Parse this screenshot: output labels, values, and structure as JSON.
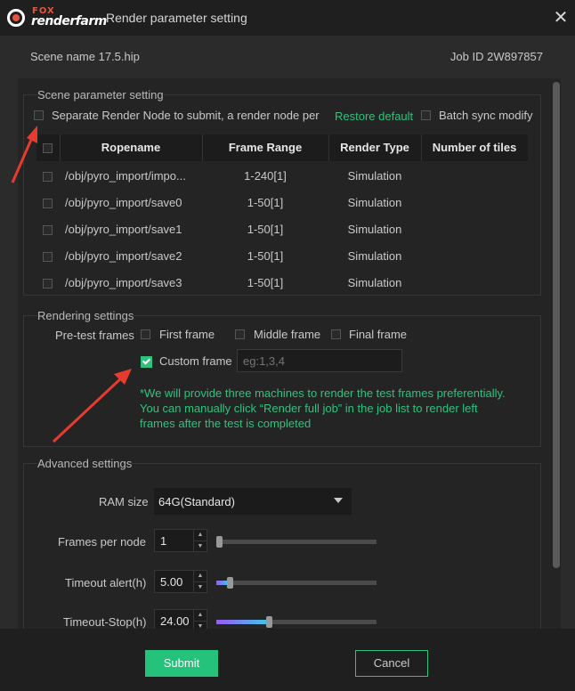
{
  "app": {
    "logo_top": "FOX",
    "logo_bottom": "renderfarm",
    "window_title": "Render parameter setting"
  },
  "info": {
    "scene_name": "Scene name  17.5.hip",
    "job_id": "Job ID  2W897857"
  },
  "scene_section": {
    "title": "Scene parameter setting",
    "separate_label": "Separate Render Node to submit, a render node per",
    "restore_default": "Restore default",
    "batch_sync_label": "Batch sync modify",
    "table": {
      "columns": [
        "Ropename",
        "Frame Range",
        "Render Type",
        "Number of tiles"
      ],
      "rows": [
        {
          "ropename": "/obj/pyro_import/impo...",
          "frame_range": "1-240[1]",
          "render_type": "Simulation",
          "tiles": ""
        },
        {
          "ropename": "/obj/pyro_import/save0",
          "frame_range": "1-50[1]",
          "render_type": "Simulation",
          "tiles": ""
        },
        {
          "ropename": "/obj/pyro_import/save1",
          "frame_range": "1-50[1]",
          "render_type": "Simulation",
          "tiles": ""
        },
        {
          "ropename": "/obj/pyro_import/save2",
          "frame_range": "1-50[1]",
          "render_type": "Simulation",
          "tiles": ""
        },
        {
          "ropename": "/obj/pyro_import/save3",
          "frame_range": "1-50[1]",
          "render_type": "Simulation",
          "tiles": ""
        }
      ]
    }
  },
  "render_section": {
    "title": "Rendering settings",
    "pretest_label": "Pre-test frames",
    "first_frame": "First frame",
    "middle_frame": "Middle frame",
    "final_frame": "Final frame",
    "custom_frame": "Custom frame",
    "custom_frame_checked": true,
    "custom_frame_placeholder": "eg:1,3,4",
    "note_lines": [
      "*We will provide three machines to render the test frames preferentially.",
      "You can manually click “Render full job” in the job list to render left",
      "frames after the test is completed"
    ]
  },
  "advanced_section": {
    "title": "Advanced settings",
    "ram_label": "RAM size",
    "ram_value": "64G(Standard)",
    "frames_per_node_label": "Frames per node",
    "frames_per_node_value": "1",
    "timeout_alert_label": "Timeout alert(h)",
    "timeout_alert_value": "5.00",
    "timeout_stop_label": "Timeout-Stop(h)",
    "timeout_stop_value": "24.00"
  },
  "footer": {
    "submit": "Submit",
    "cancel": "Cancel"
  },
  "colors": {
    "accent": "#2ec27e",
    "annotation_arrow": "#e63b2e"
  },
  "icons": [
    "close-icon",
    "dropdown-arrow-icon",
    "spin-up-icon",
    "spin-down-icon",
    "annotation-arrow"
  ]
}
